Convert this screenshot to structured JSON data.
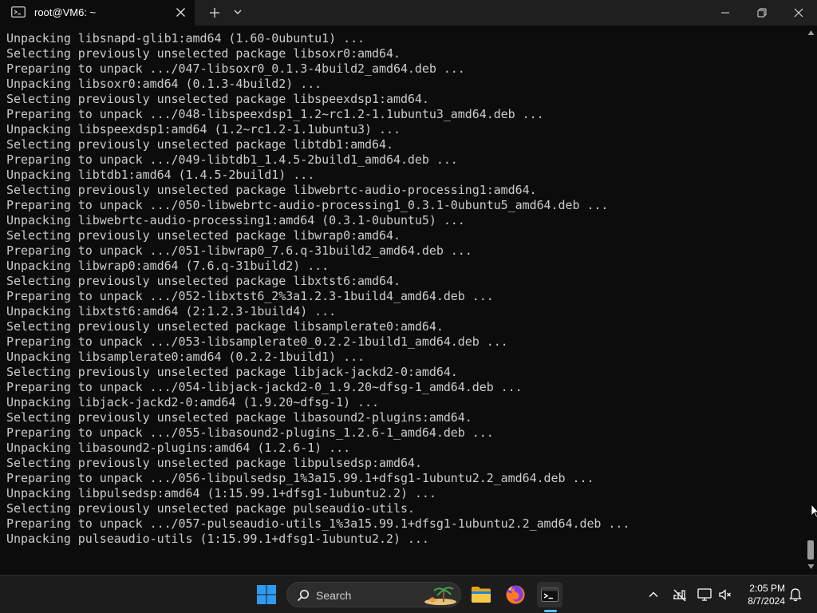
{
  "window": {
    "tab_title": "root@VM6: ~"
  },
  "terminal": {
    "lines": [
      "Unpacking libsnapd-glib1:amd64 (1.60-0ubuntu1) ...",
      "Selecting previously unselected package libsoxr0:amd64.",
      "Preparing to unpack .../047-libsoxr0_0.1.3-4build2_amd64.deb ...",
      "Unpacking libsoxr0:amd64 (0.1.3-4build2) ...",
      "Selecting previously unselected package libspeexdsp1:amd64.",
      "Preparing to unpack .../048-libspeexdsp1_1.2~rc1.2-1.1ubuntu3_amd64.deb ...",
      "Unpacking libspeexdsp1:amd64 (1.2~rc1.2-1.1ubuntu3) ...",
      "Selecting previously unselected package libtdb1:amd64.",
      "Preparing to unpack .../049-libtdb1_1.4.5-2build1_amd64.deb ...",
      "Unpacking libtdb1:amd64 (1.4.5-2build1) ...",
      "Selecting previously unselected package libwebrtc-audio-processing1:amd64.",
      "Preparing to unpack .../050-libwebrtc-audio-processing1_0.3.1-0ubuntu5_amd64.deb ...",
      "Unpacking libwebrtc-audio-processing1:amd64 (0.3.1-0ubuntu5) ...",
      "Selecting previously unselected package libwrap0:amd64.",
      "Preparing to unpack .../051-libwrap0_7.6.q-31build2_amd64.deb ...",
      "Unpacking libwrap0:amd64 (7.6.q-31build2) ...",
      "Selecting previously unselected package libxtst6:amd64.",
      "Preparing to unpack .../052-libxtst6_2%3a1.2.3-1build4_amd64.deb ...",
      "Unpacking libxtst6:amd64 (2:1.2.3-1build4) ...",
      "Selecting previously unselected package libsamplerate0:amd64.",
      "Preparing to unpack .../053-libsamplerate0_0.2.2-1build1_amd64.deb ...",
      "Unpacking libsamplerate0:amd64 (0.2.2-1build1) ...",
      "Selecting previously unselected package libjack-jackd2-0:amd64.",
      "Preparing to unpack .../054-libjack-jackd2-0_1.9.20~dfsg-1_amd64.deb ...",
      "Unpacking libjack-jackd2-0:amd64 (1.9.20~dfsg-1) ...",
      "Selecting previously unselected package libasound2-plugins:amd64.",
      "Preparing to unpack .../055-libasound2-plugins_1.2.6-1_amd64.deb ...",
      "Unpacking libasound2-plugins:amd64 (1.2.6-1) ...",
      "Selecting previously unselected package libpulsedsp:amd64.",
      "Preparing to unpack .../056-libpulsedsp_1%3a15.99.1+dfsg1-1ubuntu2.2_amd64.deb ...",
      "Unpacking libpulsedsp:amd64 (1:15.99.1+dfsg1-1ubuntu2.2) ...",
      "Selecting previously unselected package pulseaudio-utils.",
      "Preparing to unpack .../057-pulseaudio-utils_1%3a15.99.1+dfsg1-1ubuntu2.2_amd64.deb ...",
      "Unpacking pulseaudio-utils (1:15.99.1+dfsg1-1ubuntu2.2) ..."
    ]
  },
  "taskbar": {
    "search_label": "Search",
    "time": "2:05 PM",
    "date": "8/7/2024",
    "icons": {
      "start": "windows-start-icon",
      "search": "search-icon",
      "explorer": "file-explorer-icon",
      "firefox": "firefox-icon",
      "terminal": "terminal-icon"
    },
    "colors": {
      "accent": "#4cc2ff"
    }
  }
}
